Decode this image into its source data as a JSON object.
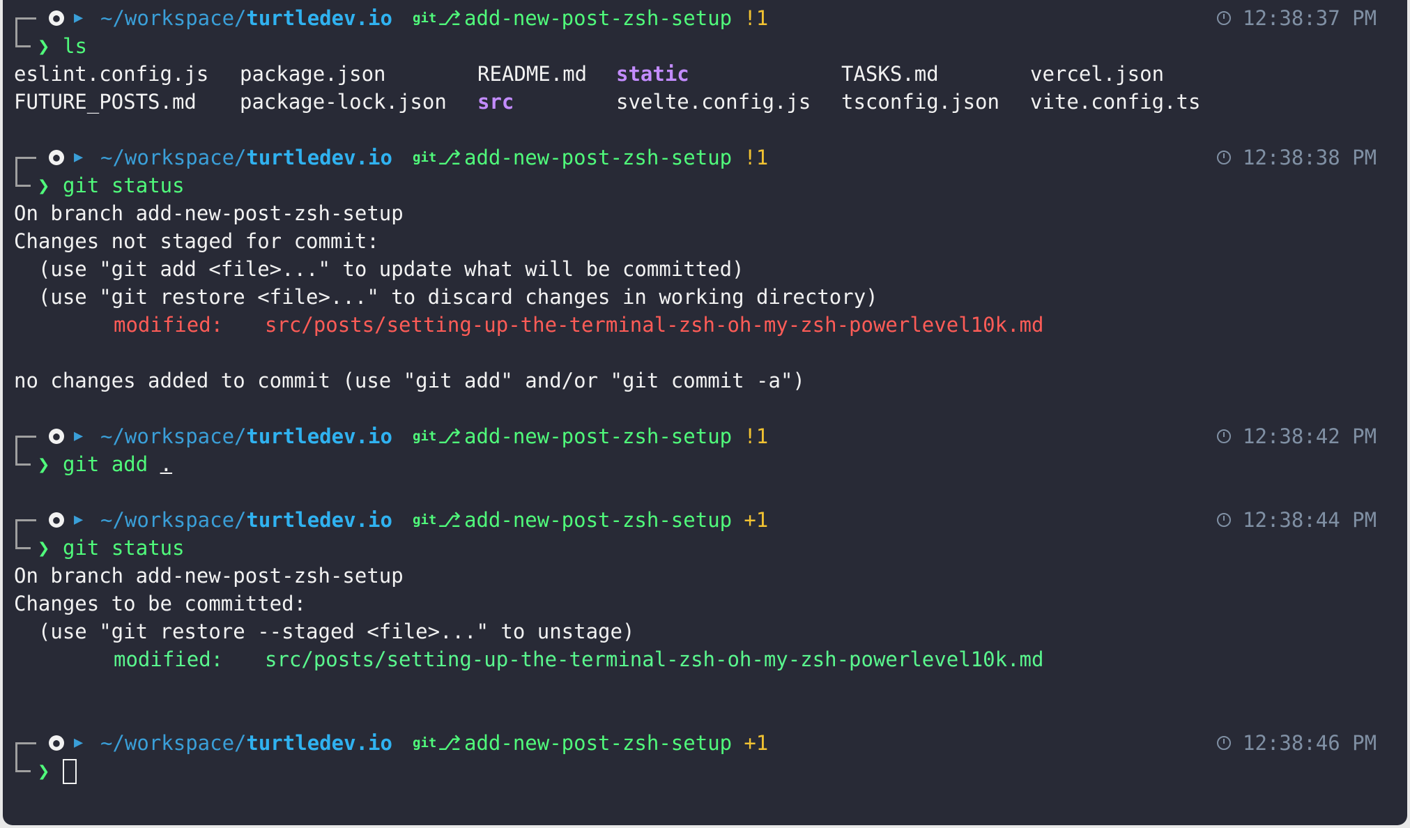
{
  "prompt": {
    "path_prefix": "~/workspace/",
    "path_repo": "turtledev.io",
    "git_label": "git",
    "branch": "add-new-post-zsh-setup",
    "chevron": "❯"
  },
  "blocks": [
    {
      "status": "!1",
      "time": "12:38:37 PM",
      "command": "ls"
    },
    {
      "status": "!1",
      "time": "12:38:38 PM",
      "command": "git status"
    },
    {
      "status": "!1",
      "time": "12:38:42 PM",
      "command": "git add",
      "command_arg": "."
    },
    {
      "status": "+1",
      "time": "12:38:44 PM",
      "command": "git status"
    },
    {
      "status": "+1",
      "time": "12:38:46 PM",
      "command": ""
    }
  ],
  "ls_output": {
    "row1": [
      "eslint.config.js",
      "package.json",
      "README.md",
      "static",
      "TASKS.md",
      "vercel.json"
    ],
    "row2": [
      "FUTURE_POSTS.md",
      "package-lock.json",
      "src",
      "svelte.config.js",
      "tsconfig.json",
      "vite.config.ts"
    ]
  },
  "status1": {
    "branch_line": "On branch add-new-post-zsh-setup",
    "header": "Changes not staged for commit:",
    "hint1": "  (use \"git add <file>...\" to update what will be committed)",
    "hint2": "  (use \"git restore <file>...\" to discard changes in working directory)",
    "modified_label": "modified:",
    "modified_file": "src/posts/setting-up-the-terminal-zsh-oh-my-zsh-powerlevel10k.md",
    "footer": "no changes added to commit (use \"git add\" and/or \"git commit -a\")"
  },
  "status2": {
    "branch_line": "On branch add-new-post-zsh-setup",
    "header": "Changes to be committed:",
    "hint1": "  (use \"git restore --staged <file>...\" to unstage)",
    "modified_label": "modified:",
    "modified_file": "src/posts/setting-up-the-terminal-zsh-oh-my-zsh-powerlevel10k.md"
  },
  "colors": {
    "background": "#282a36",
    "foreground": "#f2f2f2",
    "green": "#50fa7b",
    "blue": "#30b2f0",
    "yellow": "#f1c232",
    "red": "#ff5c57",
    "purple": "#c38cff",
    "time": "#8090a4"
  },
  "icons": {
    "os": "apple-icon",
    "folder": "folder-icon",
    "branch": "git-branch-icon",
    "clock": "clock-icon"
  }
}
